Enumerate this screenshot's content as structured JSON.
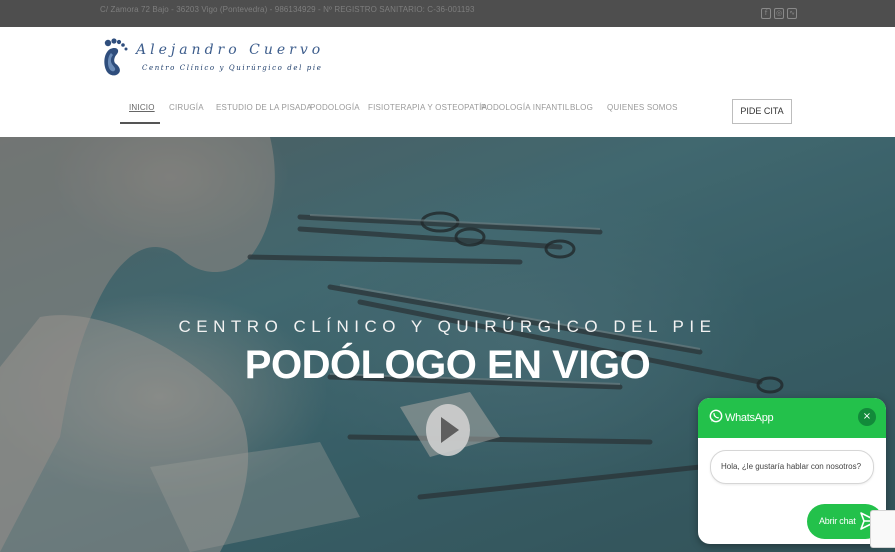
{
  "topbar": {
    "info": "C/ Zamora 72 Bajo - 36203 Vigo (Pontevedra) - 986134929 - Nº REGISTRO SANITARIO: C-36-001193",
    "social": [
      {
        "icon": "facebook-icon",
        "glyph": "f"
      },
      {
        "icon": "instagram-icon",
        "glyph": "◎"
      },
      {
        "icon": "rss-icon",
        "glyph": "∿"
      }
    ]
  },
  "brand": {
    "name": "Alejandro Cuervo",
    "tagline": "Centro Clínico y Quirúrgico del pie",
    "color": "#3d5d8c"
  },
  "nav": {
    "items": [
      "INICIO",
      "CIRUGÍA",
      "ESTUDIO DE LA PISADA",
      "PODOLOGÍA",
      "FISIOTERAPIA Y OSTEOPATÍA",
      "PODOLOGÍA INFANTIL",
      "BLOG",
      "QUIENES SOMOS"
    ],
    "active": "INICIO",
    "cta": "PIDE CITA"
  },
  "hero": {
    "subtitle": "CENTRO CLÍNICO Y QUIRÚRGICO DEL PIE",
    "title": "PODÓLOGO EN VIGO"
  },
  "whatsapp": {
    "title": "WhatsApp",
    "close": "×",
    "message": "Hola, ¿le gustaría hablar con nosotros?",
    "open_label": "Abrir chat",
    "color": "#23c14b"
  }
}
